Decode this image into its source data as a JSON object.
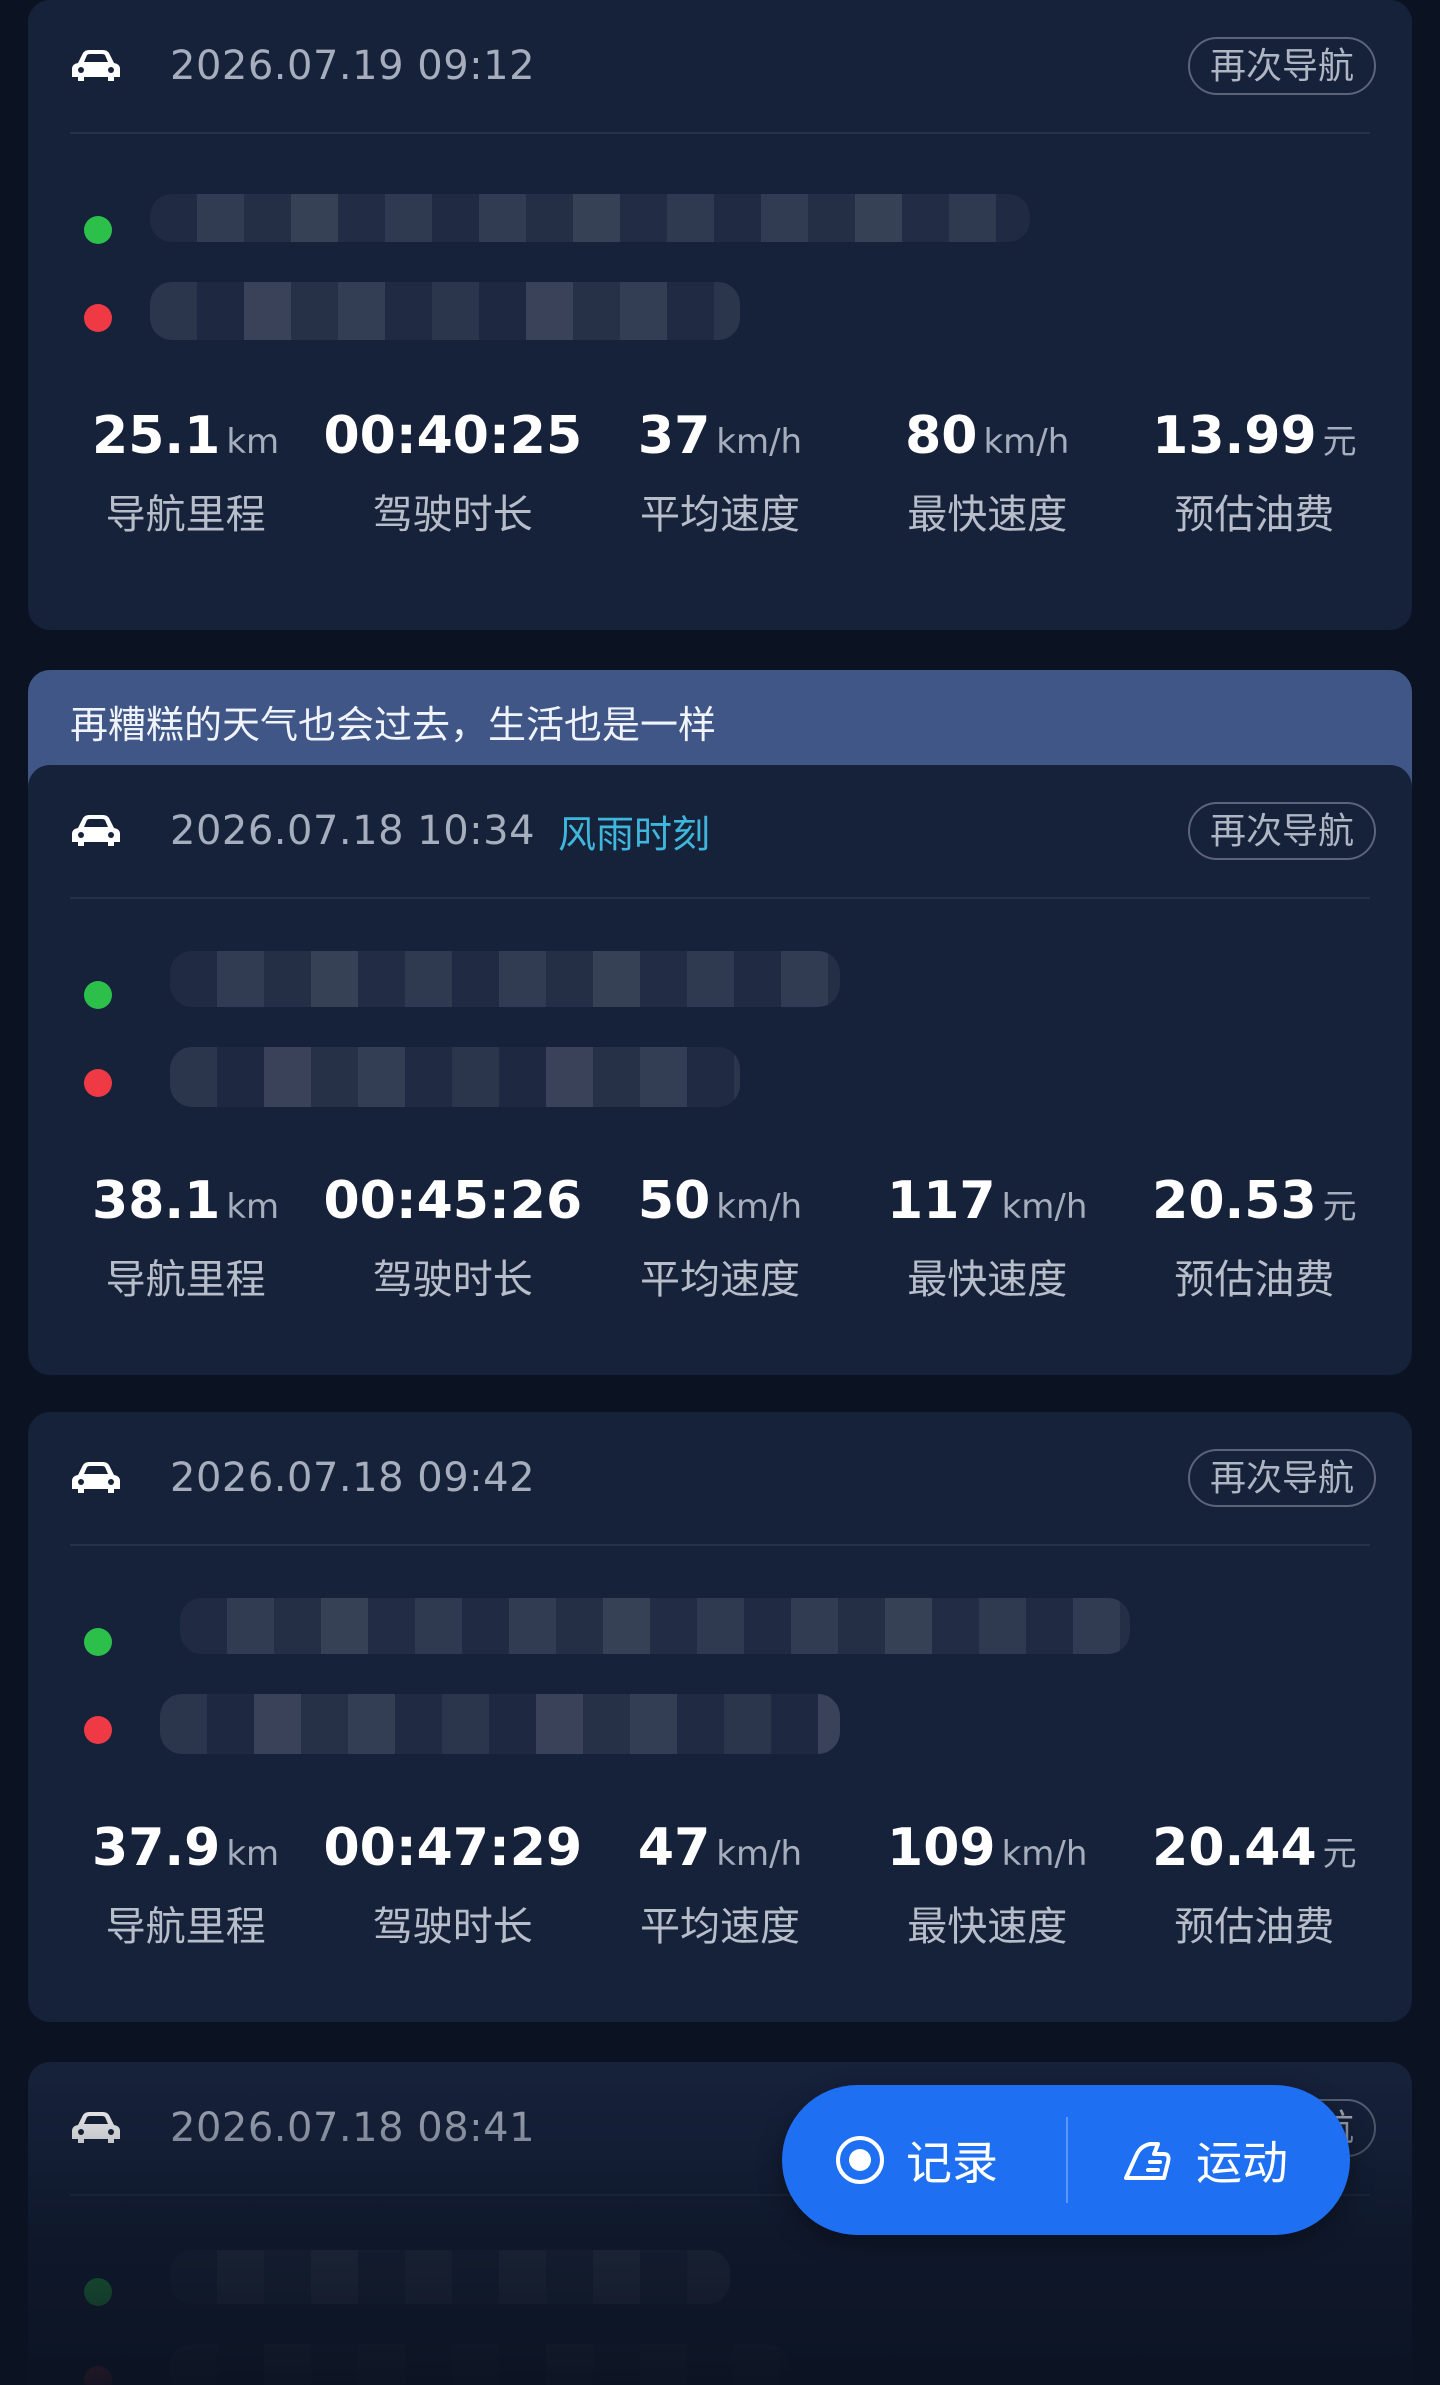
{
  "renav_label": "再次导航",
  "labels": {
    "distance": "导航里程",
    "duration": "驾驶时长",
    "avg_speed": "平均速度",
    "max_speed": "最快速度",
    "fuel": "预估油费"
  },
  "units": {
    "km": "km",
    "kmh": "km/h",
    "yuan": "元"
  },
  "banner": {
    "text": "再糟糕的天气也会过去，生活也是一样"
  },
  "trips": [
    {
      "datetime": "2026.07.19 09:12",
      "tag": "",
      "distance": "25.1",
      "duration": "00:40:25",
      "avg_speed": "37",
      "max_speed": "80",
      "fuel": "13.99"
    },
    {
      "datetime": "2026.07.18 10:34",
      "tag": "风雨时刻",
      "distance": "38.1",
      "duration": "00:45:26",
      "avg_speed": "50",
      "max_speed": "117",
      "fuel": "20.53"
    },
    {
      "datetime": "2026.07.18 09:42",
      "tag": "",
      "distance": "37.9",
      "duration": "00:47:29",
      "avg_speed": "47",
      "max_speed": "109",
      "fuel": "20.44"
    },
    {
      "datetime": "2026.07.18 08:41",
      "tag": ""
    }
  ],
  "fab": {
    "record_label": "记录",
    "sport_label": "运动",
    "record_icon": "record-icon",
    "sport_icon": "sport-icon"
  },
  "colors": {
    "background": "#0b1322",
    "card": "#16213a",
    "banner": "#3f5687",
    "start_dot": "#2cc04a",
    "end_dot": "#ef3a45",
    "tag": "#3fb7dd",
    "fab": "#1f6ff3"
  }
}
